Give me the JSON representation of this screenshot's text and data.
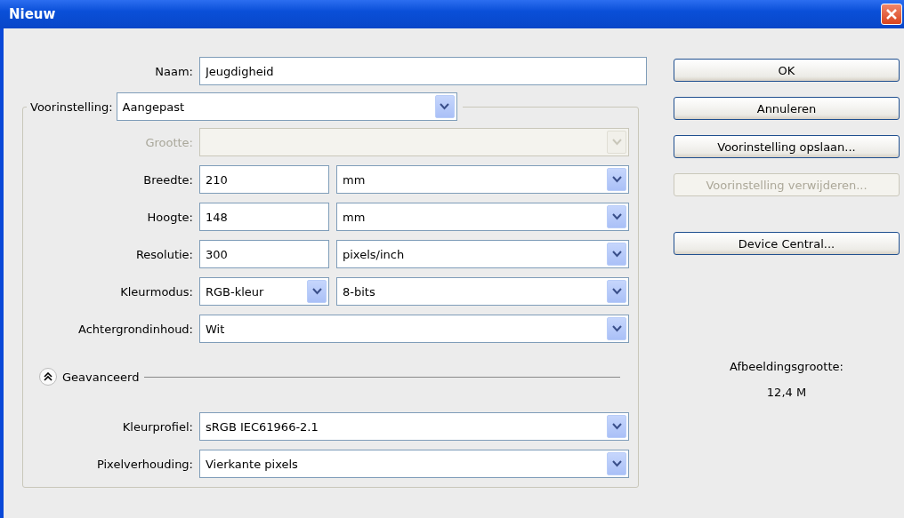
{
  "window": {
    "title": "Nieuw"
  },
  "name_field": {
    "label": "Naam:",
    "value": "Jeugdigheid"
  },
  "preset": {
    "label": "Voorinstelling:",
    "value": "Aangepast"
  },
  "rows": [
    {
      "label": "Grootte:",
      "disabled": true,
      "controls": [
        {
          "kind": "select",
          "disabled": true
        }
      ]
    },
    {
      "label": "Breedte:",
      "disabled": false,
      "controls": [
        {
          "kind": "input",
          "value": "210"
        },
        {
          "kind": "select",
          "value": "mm"
        }
      ]
    },
    {
      "label": "Hoogte:",
      "disabled": false,
      "controls": [
        {
          "kind": "input",
          "value": "148"
        },
        {
          "kind": "select",
          "value": "mm"
        }
      ]
    },
    {
      "label": "Resolutie:",
      "disabled": false,
      "controls": [
        {
          "kind": "input",
          "value": "300"
        },
        {
          "kind": "select",
          "value": "pixels/inch"
        }
      ]
    },
    {
      "label": "Kleurmodus:",
      "disabled": false,
      "controls": [
        {
          "kind": "select",
          "value": "RGB-kleur"
        },
        {
          "kind": "select",
          "value": "8-bits"
        }
      ]
    },
    {
      "label": "Achtergrondinhoud:",
      "disabled": false,
      "controls": [
        {
          "kind": "select",
          "value": "Wit"
        }
      ]
    }
  ],
  "advanced": {
    "label": "Geavanceerd",
    "expanded": true,
    "rows": [
      {
        "label": "Kleurprofiel:",
        "disabled": false,
        "controls": [
          {
            "kind": "select",
            "value": "sRGB IEC61966-2.1"
          }
        ]
      },
      {
        "label": "Pixelverhouding:",
        "disabled": false,
        "controls": [
          {
            "kind": "select",
            "value": "Vierkante pixels"
          }
        ]
      }
    ]
  },
  "buttons": [
    {
      "label": "OK",
      "disabled": false,
      "kind": "button"
    },
    {
      "label": "Annuleren",
      "disabled": false,
      "kind": "button"
    },
    {
      "label": "Voorinstelling opslaan...",
      "disabled": false,
      "kind": "button"
    },
    {
      "label": "Voorinstelling verwijderen...",
      "disabled": true,
      "kind": "button"
    },
    {
      "label": "Device Central...",
      "disabled": false,
      "kind": "spaced"
    }
  ],
  "image_size": {
    "label": "Afbeeldingsgrootte:",
    "value": "12,4 M"
  }
}
